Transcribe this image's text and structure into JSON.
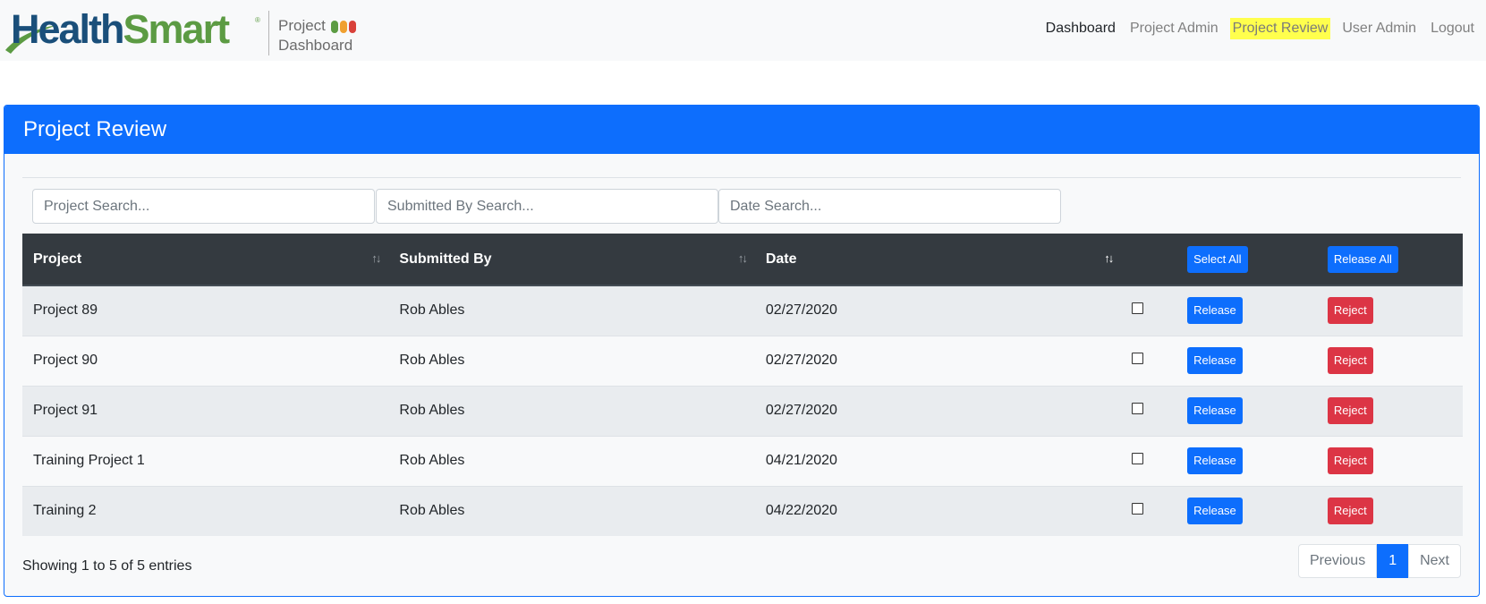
{
  "brand": {
    "name_part1": "Health",
    "name_part2": "Smart",
    "registered": "®",
    "subtitle_line1": "Project",
    "subtitle_line2": "Dashboard",
    "pill_colors": [
      "#5c9b43",
      "#f0a030",
      "#d9413a"
    ]
  },
  "nav": {
    "items": [
      {
        "label": "Dashboard"
      },
      {
        "label": "Project Admin"
      },
      {
        "label": "Project Review"
      },
      {
        "label": "User Admin"
      },
      {
        "label": "Logout"
      }
    ]
  },
  "card": {
    "title": "Project Review"
  },
  "search": {
    "project_placeholder": "Project Search...",
    "submitted_placeholder": "Submitted By Search...",
    "date_placeholder": "Date Search..."
  },
  "table": {
    "headers": {
      "project": "Project",
      "submitted_by": "Submitted By",
      "date": "Date",
      "select_all": "Select All",
      "release_all": "Release All"
    },
    "sort_icon": "↑↓",
    "release_label": "Release",
    "reject_label": "Reject",
    "rows": [
      {
        "project": "Project 89",
        "submitted_by": "Rob Ables",
        "date": "02/27/2020"
      },
      {
        "project": "Project 90",
        "submitted_by": "Rob Ables",
        "date": "02/27/2020"
      },
      {
        "project": "Project 91",
        "submitted_by": "Rob Ables",
        "date": "02/27/2020"
      },
      {
        "project": "Training Project 1",
        "submitted_by": "Rob Ables",
        "date": "04/21/2020"
      },
      {
        "project": "Training 2",
        "submitted_by": "Rob Ables",
        "date": "04/22/2020"
      }
    ]
  },
  "footer": {
    "info": "Showing 1 to 5 of 5 entries",
    "previous": "Previous",
    "current_page": "1",
    "next": "Next"
  },
  "colors": {
    "primary": "#0d6efd",
    "danger": "#dc3545",
    "table_header": "#343a40",
    "nav_highlight": "#ffff4d"
  }
}
